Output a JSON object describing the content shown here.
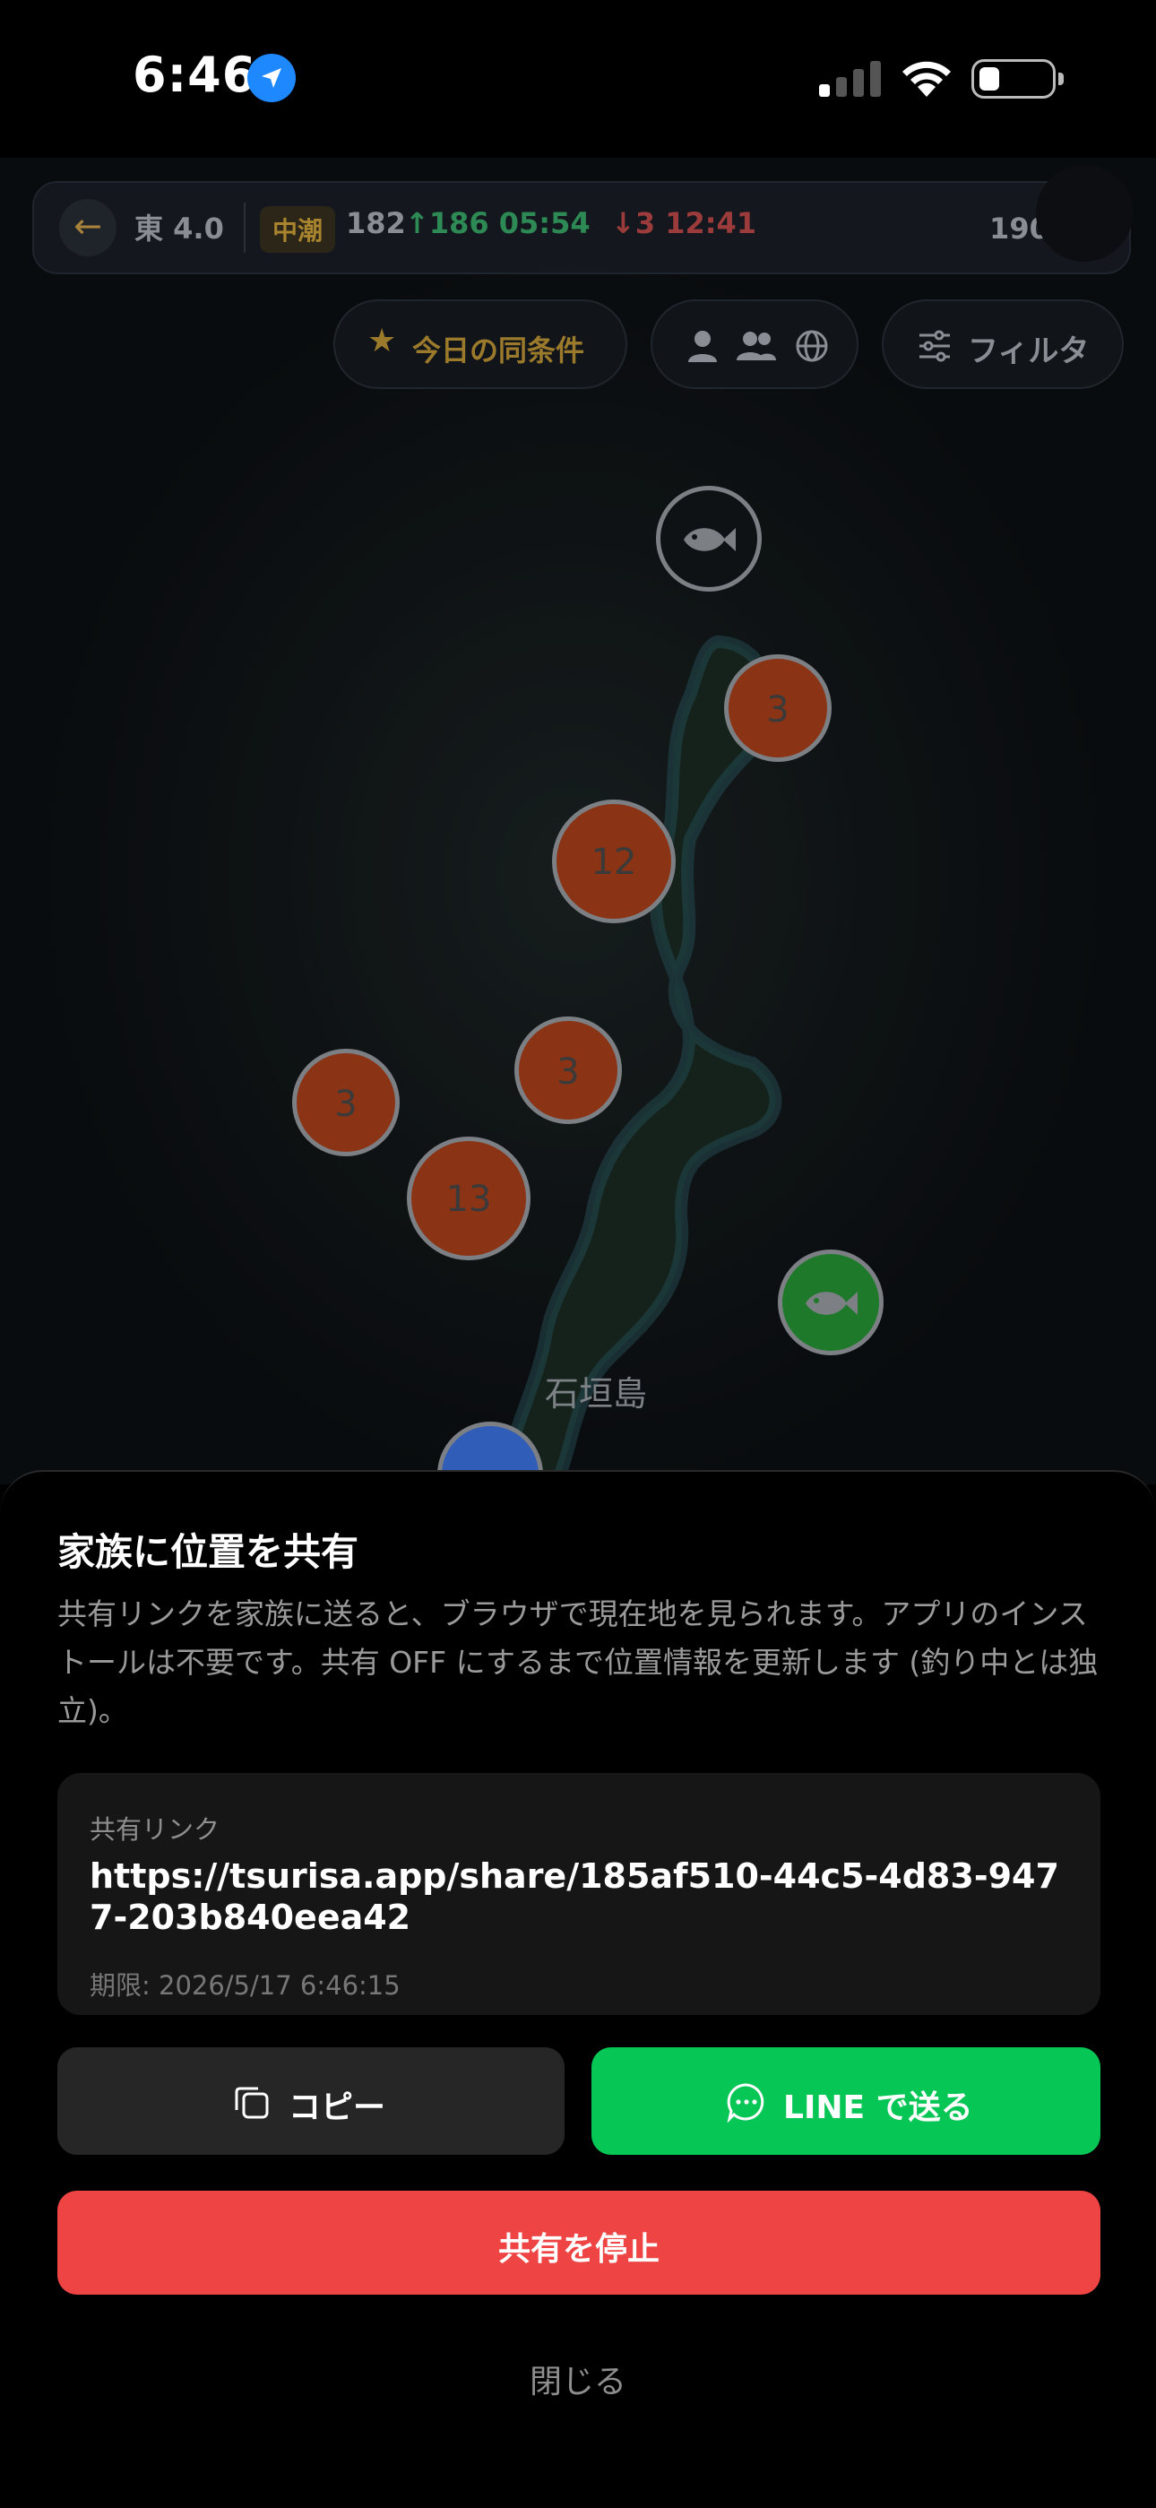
{
  "status_bar": {
    "time": "6:46"
  },
  "map": {
    "header": {
      "back_icon": "arrow-left-icon",
      "wind": "東 4.0",
      "tide_badge": "中潮",
      "tide_value": "182",
      "tide_high": "↑186 05:54",
      "tide_low": "↓3 12:41",
      "count": "190 件"
    },
    "chips": {
      "today_label": "今日の同条件",
      "filter_label": "フィルタ"
    },
    "clusters": [
      "3",
      "12",
      "3",
      "3",
      "13"
    ],
    "island_label": "石垣島",
    "colors": {
      "cluster": "#8a3415",
      "green_marker": "#1e7a2a",
      "blue_marker": "#2f5db7"
    }
  },
  "sheet": {
    "title": "家族に位置を共有",
    "description": "共有リンクを家族に送ると、ブラウザで現在地を見られます。アプリのインストールは不要です。共有 OFF にするまで位置情報を更新します (釣り中とは独立)。",
    "link_label": "共有リンク",
    "link_url": "https://tsurisa.app/share/185af510-44c5-4d83-9477-203b840eea42",
    "expiry": "期限: 2026/5/17 6:46:15",
    "copy_label": "コピー",
    "line_label": "LINE で送る",
    "stop_label": "共有を停止",
    "close_label": "閉じる",
    "colors": {
      "line": "#06c755",
      "stop": "#ef4444"
    }
  }
}
